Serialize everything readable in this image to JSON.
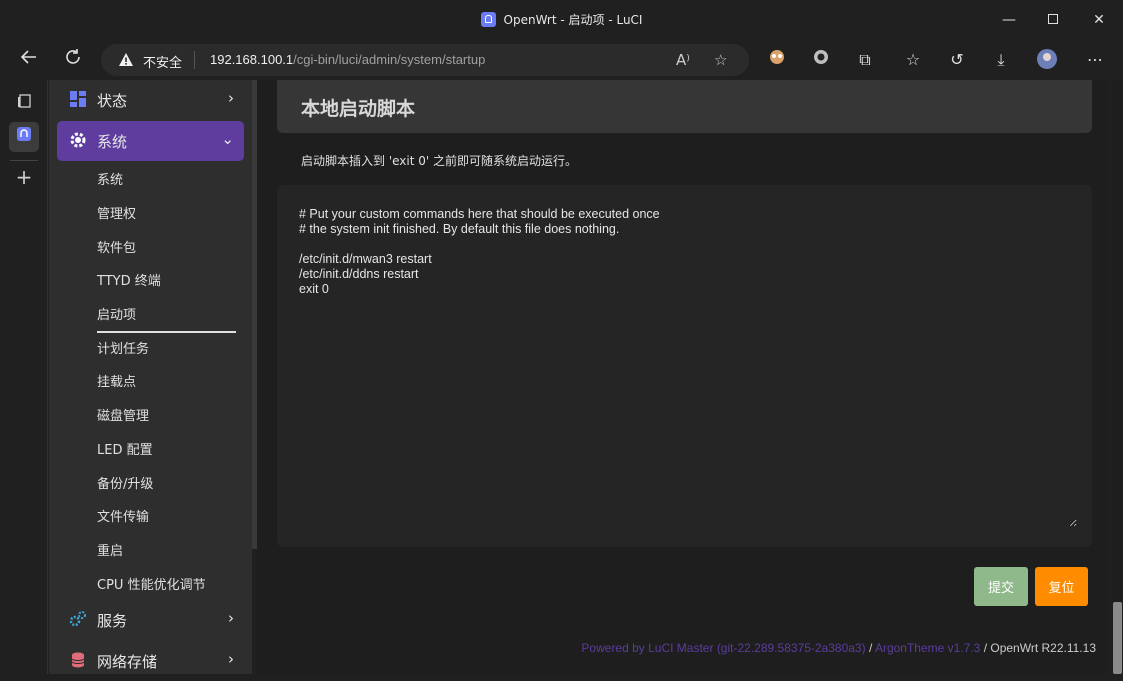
{
  "window": {
    "title": "OpenWrt - 启动项 - LuCI"
  },
  "browser": {
    "security_label": "不安全",
    "url_host": "192.168.100.1",
    "url_path": "/cgi-bin/luci/admin/system/startup"
  },
  "sidebar": {
    "status_label": "状态",
    "system_label": "系统",
    "system_items": [
      "系统",
      "管理权",
      "软件包",
      "TTYD 终端",
      "启动项",
      "计划任务",
      "挂载点",
      "磁盘管理",
      "LED 配置",
      "备份/升级",
      "文件传输",
      "重启",
      "CPU 性能优化调节"
    ],
    "services_label": "服务",
    "nas_label": "网络存储"
  },
  "page": {
    "title": "本地启动脚本",
    "description": "启动脚本插入到 'exit 0' 之前即可随系统启动运行。",
    "script": "# Put your custom commands here that should be executed once\n# the system init finished. By default this file does nothing.\n\n/etc/init.d/mwan3 restart\n/etc/init.d/ddns restart\nexit 0",
    "submit_label": "提交",
    "reset_label": "复位"
  },
  "footer": {
    "luci_link": "Powered by LuCI Master (git-22.289.58375-2a380a3)",
    "sep1": " / ",
    "theme_link": "ArgonTheme v1.7.3",
    "sep2": " / ",
    "version": "OpenWrt R22.11.13"
  },
  "colors": {
    "accent": "#5e3d9e",
    "submit": "#8fb98b",
    "reset": "#ff8c00"
  }
}
